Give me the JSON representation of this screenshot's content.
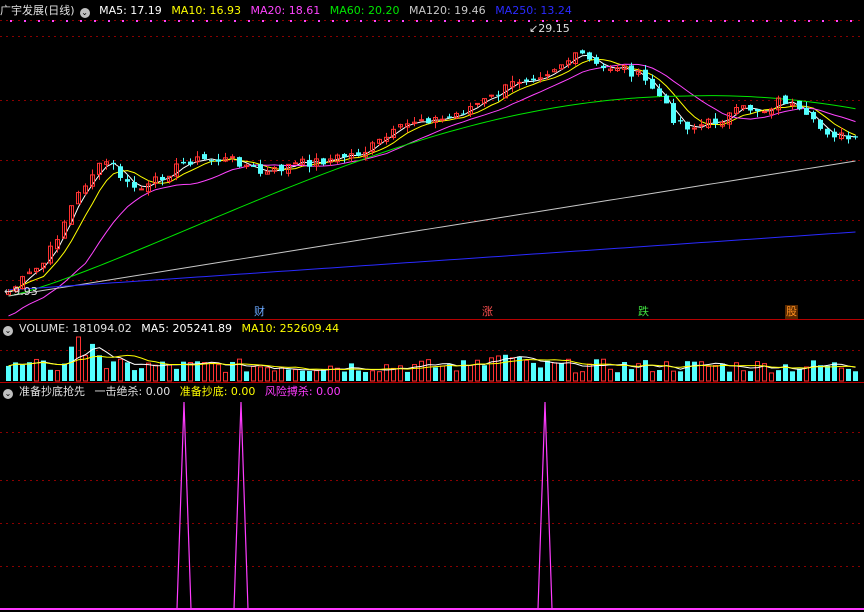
{
  "colors": {
    "up": "#ff3232",
    "down": "#54ffff",
    "ma5": "#ffffff",
    "ma10": "#ffff00",
    "ma20": "#ff44ff",
    "ma60": "#00e600",
    "ma120": "#c8c8c8",
    "ma250": "#2a2aff",
    "grid": "#8b0000",
    "divider": "#b40000",
    "signal": "#ff3cff"
  },
  "main": {
    "title": "广宇发展(日线)",
    "indicators": [
      {
        "label": "MA5: 17.19",
        "color": "#ffffff"
      },
      {
        "label": "MA10: 16.93",
        "color": "#ffff00"
      },
      {
        "label": "MA20: 18.61",
        "color": "#ff44ff"
      },
      {
        "label": "MA60: 20.20",
        "color": "#00e600"
      },
      {
        "label": "MA120: 19.46",
        "color": "#c8c8c8"
      },
      {
        "label": "MA250: 13.24",
        "color": "#2a2aff"
      }
    ],
    "high_label": "29.15",
    "low_label": "9.93",
    "event_tags": [
      {
        "label": "财",
        "color": "#6aa8ff",
        "bg": "#000000"
      },
      {
        "label": "涨",
        "color": "#ff5050",
        "bg": "#000000"
      },
      {
        "label": "跌",
        "color": "#40e040",
        "bg": "#000000"
      },
      {
        "label": "股",
        "color": "#ff9020",
        "bg": "#5a2a00"
      }
    ]
  },
  "volume": {
    "title": "VOLUME: 181094.02",
    "ma5": "MA5: 205241.89",
    "ma10": "MA10: 252609.44"
  },
  "indicator": {
    "title": "准备抄底抢先",
    "items": [
      {
        "label": "一击绝杀: 0.00",
        "color": "#e0e0e0"
      },
      {
        "label": "准备抄底: 0.00",
        "color": "#ffff00"
      },
      {
        "label": "风险搏杀: 0.00",
        "color": "#ff3cff"
      }
    ]
  }
}
